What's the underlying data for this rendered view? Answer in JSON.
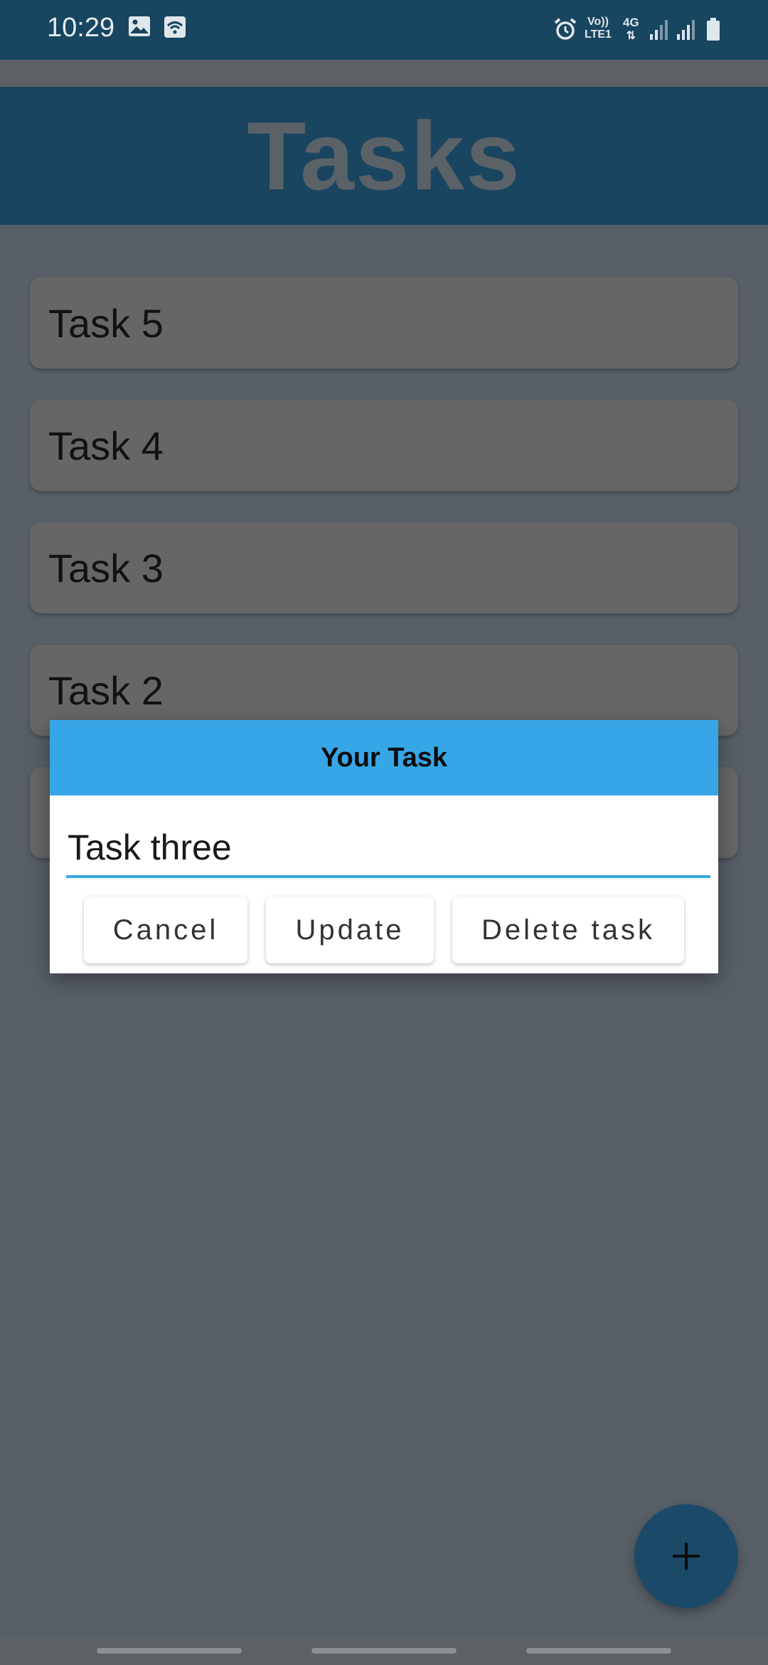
{
  "status_bar": {
    "time": "10:29",
    "icons": [
      "image-icon",
      "wifi-calling-icon",
      "alarm-icon",
      "volte-icon",
      "4g-data-icon",
      "signal-icon",
      "signal-icon",
      "battery-icon"
    ],
    "volte_label_top": "Vo))",
    "volte_label_bottom": "LTE1",
    "data_label": "4G"
  },
  "app_bar": {
    "title": "Tasks"
  },
  "tasks": [
    {
      "label": "Task 5"
    },
    {
      "label": "Task 4"
    },
    {
      "label": "Task 3"
    },
    {
      "label": "Task 2"
    }
  ],
  "dialog": {
    "title": "Your Task",
    "input_value": "Task three",
    "cancel_label": "Cancel",
    "update_label": "Update",
    "delete_label": "Delete task"
  },
  "fab": {
    "icon": "plus-icon"
  },
  "colors": {
    "status_bar": "#18455f",
    "app_bar": "#1a4560",
    "dialog_accent": "#37a6e6",
    "scrim_background": "#585f67"
  }
}
